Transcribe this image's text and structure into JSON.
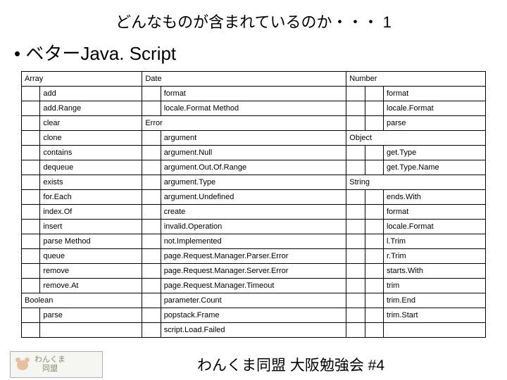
{
  "title": "どんなものが含まれているのか・・・ 1",
  "bullet": "• ベターJava. Script",
  "footer": {
    "logo_line1": "わんくま",
    "logo_line2": "　同盟",
    "caption": "わんくま同盟 大阪勉強会 #4"
  },
  "rows": [
    [
      [
        "Array",
        2
      ],
      [
        "Date",
        2
      ],
      [
        "Number",
        3
      ]
    ],
    [
      [
        "",
        1
      ],
      [
        "add",
        1
      ],
      [
        "",
        1
      ],
      [
        "format",
        1
      ],
      [
        "",
        1
      ],
      [
        "",
        1
      ],
      [
        "format",
        1
      ]
    ],
    [
      [
        "",
        1
      ],
      [
        "add.Range",
        1
      ],
      [
        "",
        1
      ],
      [
        "locale.Format Method",
        1
      ],
      [
        "",
        1
      ],
      [
        "",
        1
      ],
      [
        "locale.Format",
        1
      ]
    ],
    [
      [
        "",
        1
      ],
      [
        "clear",
        1
      ],
      [
        "Error",
        2
      ],
      [
        "",
        1
      ],
      [
        "",
        1
      ],
      [
        "parse",
        1
      ]
    ],
    [
      [
        "",
        1
      ],
      [
        "clone",
        1
      ],
      [
        "",
        1
      ],
      [
        "argument",
        1
      ],
      [
        "Object",
        3
      ]
    ],
    [
      [
        "",
        1
      ],
      [
        "contains",
        1
      ],
      [
        "",
        1
      ],
      [
        "argument.Null",
        1
      ],
      [
        "",
        1
      ],
      [
        "",
        1
      ],
      [
        "get.Type",
        1
      ]
    ],
    [
      [
        "",
        1
      ],
      [
        "dequeue",
        1
      ],
      [
        "",
        1
      ],
      [
        "argument.Out.Of.Range",
        1
      ],
      [
        "",
        1
      ],
      [
        "",
        1
      ],
      [
        "get.Type.Name",
        1
      ]
    ],
    [
      [
        "",
        1
      ],
      [
        "exists",
        1
      ],
      [
        "",
        1
      ],
      [
        "argument.Type",
        1
      ],
      [
        "String",
        3
      ]
    ],
    [
      [
        "",
        1
      ],
      [
        "for.Each",
        1
      ],
      [
        "",
        1
      ],
      [
        "argument.Undefined",
        1
      ],
      [
        "",
        1
      ],
      [
        "",
        1
      ],
      [
        "ends.With",
        1
      ]
    ],
    [
      [
        "",
        1
      ],
      [
        "index.Of",
        1
      ],
      [
        "",
        1
      ],
      [
        "create",
        1
      ],
      [
        "",
        1
      ],
      [
        "",
        1
      ],
      [
        "format",
        1
      ]
    ],
    [
      [
        "",
        1
      ],
      [
        "insert",
        1
      ],
      [
        "",
        1
      ],
      [
        "invalid.Operation",
        1
      ],
      [
        "",
        1
      ],
      [
        "",
        1
      ],
      [
        "locale.Format",
        1
      ]
    ],
    [
      [
        "",
        1
      ],
      [
        "parse Method",
        1
      ],
      [
        "",
        1
      ],
      [
        "not.Implemented",
        1
      ],
      [
        "",
        1
      ],
      [
        "",
        1
      ],
      [
        "l.Trim",
        1
      ]
    ],
    [
      [
        "",
        1
      ],
      [
        "queue",
        1
      ],
      [
        "",
        1
      ],
      [
        "page.Request.Manager.Parser.Error",
        1
      ],
      [
        "",
        1
      ],
      [
        "",
        1
      ],
      [
        "r.Trim",
        1
      ]
    ],
    [
      [
        "",
        1
      ],
      [
        "remove",
        1
      ],
      [
        "",
        1
      ],
      [
        "page.Request.Manager.Server.Error",
        1
      ],
      [
        "",
        1
      ],
      [
        "",
        1
      ],
      [
        "starts.With",
        1
      ]
    ],
    [
      [
        "",
        1
      ],
      [
        "remove.At",
        1
      ],
      [
        "",
        1
      ],
      [
        "page.Request.Manager.Timeout",
        1
      ],
      [
        "",
        1
      ],
      [
        "",
        1
      ],
      [
        "trim",
        1
      ]
    ],
    [
      [
        "Boolean",
        2
      ],
      [
        "",
        1
      ],
      [
        "parameter.Count",
        1
      ],
      [
        "",
        1
      ],
      [
        "",
        1
      ],
      [
        "trim.End",
        1
      ]
    ],
    [
      [
        "",
        1
      ],
      [
        "parse",
        1
      ],
      [
        "",
        1
      ],
      [
        "popstack.Frame",
        1
      ],
      [
        "",
        1
      ],
      [
        "",
        1
      ],
      [
        "trim.Start",
        1
      ]
    ],
    [
      [
        "",
        1
      ],
      [
        "",
        1
      ],
      [
        "",
        1
      ],
      [
        "script.Load.Failed",
        1
      ],
      [
        "",
        1
      ],
      [
        "",
        1
      ],
      [
        "",
        1
      ]
    ]
  ]
}
